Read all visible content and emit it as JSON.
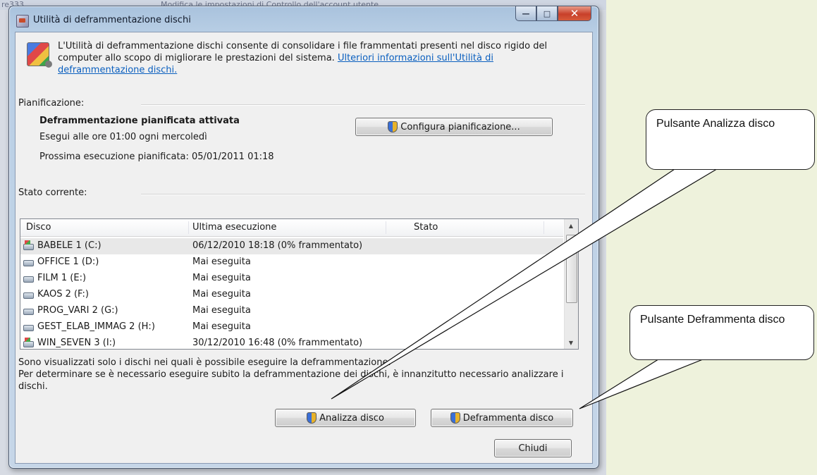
{
  "backdrop": {
    "left_fragment": "re333",
    "top_fragment": "Modifica le impostazioni di Controllo dell'account utente"
  },
  "window": {
    "title": "Utilità di deframmentazione dischi",
    "intro_text": "L'Utilità di deframmentazione dischi consente di consolidare i file frammentati presenti nel disco rigido del computer allo scopo di migliorare le prestazioni del sistema.",
    "intro_link": "Ulteriori informazioni sull'Utilità di deframmentazione dischi.",
    "schedule": {
      "group_label": "Pianificazione:",
      "status": "Deframmentazione pianificata attivata",
      "when": "Esegui alle ore 01:00 ogni mercoledì",
      "next_run": "Prossima esecuzione pianificata: 05/01/2011 01:18",
      "configure_button": "Configura pianificazione..."
    },
    "current_status": {
      "group_label": "Stato corrente:",
      "columns": [
        "Disco",
        "Ultima esecuzione",
        "Stato"
      ],
      "rows": [
        {
          "disk": "BABELE 1 (C:)",
          "last_run": "06/12/2010 18:18 (0% frammentato)",
          "status": ""
        },
        {
          "disk": "OFFICE 1 (D:)",
          "last_run": "Mai eseguita",
          "status": ""
        },
        {
          "disk": "FILM 1 (E:)",
          "last_run": "Mai eseguita",
          "status": ""
        },
        {
          "disk": "KAOS 2 (F:)",
          "last_run": "Mai eseguita",
          "status": ""
        },
        {
          "disk": "PROG_VARI 2 (G:)",
          "last_run": "Mai eseguita",
          "status": ""
        },
        {
          "disk": "GEST_ELAB_IMMAG 2 (H:)",
          "last_run": "Mai eseguita",
          "status": ""
        },
        {
          "disk": "WIN_SEVEN 3 (I:)",
          "last_run": "30/12/2010 16:48 (0% frammentato)",
          "status": ""
        }
      ]
    },
    "info_line1": "Sono visualizzati solo i dischi nei quali è possibile eseguire la deframmentazione.",
    "info_line2": "Per determinare se è necessario eseguire subito la deframmentazione dei dischi, è innanzitutto necessario analizzare i dischi.",
    "analyze_button": "Analizza disco",
    "defrag_button": "Deframmenta disco",
    "close_button": "Chiudi"
  },
  "callouts": {
    "analyze": "Pulsante Analizza disco",
    "defrag": "Pulsante Deframmenta disco"
  }
}
